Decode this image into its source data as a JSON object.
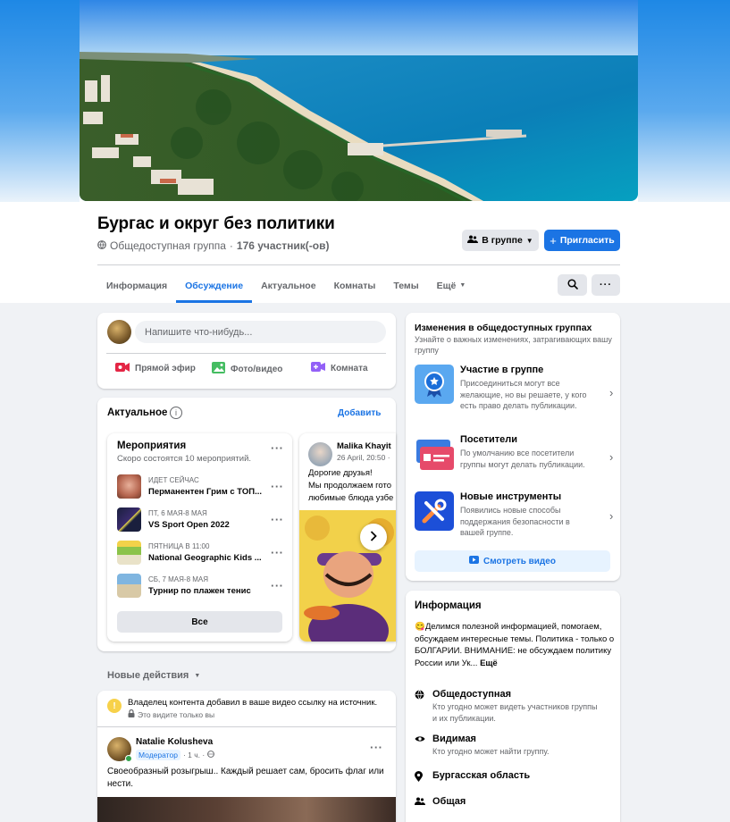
{
  "colors": {
    "accent": "#1b74e4",
    "muted": "#65676b",
    "bg": "#f0f2f5"
  },
  "group": {
    "title": "Бургас и округ без политики",
    "privacy": "Общедоступная группа",
    "separator": "·",
    "members": "176 участник(-ов)"
  },
  "actions": {
    "in_group": "В группе",
    "invite": "Пригласить"
  },
  "tabs": [
    {
      "label": "Информация",
      "active": false
    },
    {
      "label": "Обсуждение",
      "active": true
    },
    {
      "label": "Актуальное",
      "active": false
    },
    {
      "label": "Комнаты",
      "active": false
    },
    {
      "label": "Темы",
      "active": false
    },
    {
      "label": "Ещё",
      "active": false
    }
  ],
  "composer": {
    "placeholder": "Напишите что-нибудь...",
    "live": "Прямой эфир",
    "photo": "Фото/видео",
    "room": "Комната"
  },
  "featured": {
    "title": "Актуальное",
    "add": "Добавить",
    "events_card": {
      "title": "Мероприятия",
      "subtitle": "Скоро состоятся 10 мероприятий.",
      "items": [
        {
          "meta": "ИДЕТ СЕЙЧАС",
          "name": "Перманентен Грим с ТОП..."
        },
        {
          "meta": "ПТ, 6 МАЯ-8 МАЯ",
          "name": "VS Sport Open 2022"
        },
        {
          "meta": "ПЯТНИЦА В 11:00",
          "name": "National Geographic Kids ..."
        },
        {
          "meta": "СБ, 7 МАЯ-8 МАЯ",
          "name": "Турнир по плажен тенис"
        }
      ],
      "all": "Все"
    },
    "post_card": {
      "author": "Malika Khayit",
      "date": "26 April, 20:50 ·",
      "line1": "Дорогие друзья!",
      "line2": "Мы продолжаем гото",
      "line3": "любимые блюда узбе"
    }
  },
  "activity": {
    "title": "Новые действия",
    "notice": "Владелец контента добавил в ваше видео ссылку на источник.",
    "notice_sub": "Это видите только вы",
    "post": {
      "author": "Natalie Kolusheva",
      "role": "Модератор",
      "time": "· 1 ч. ·",
      "text": "Своеобразный розыгрыш.. Каждый решает сам, бросить флаг или нести."
    }
  },
  "changes": {
    "title": "Изменения в общедоступных группах",
    "subtitle": "Узнайте о важных изменениях, затрагивающих вашу группу",
    "items": [
      {
        "title": "Участие в группе",
        "text": "Присоединиться могут все желающие, но вы решаете, у кого есть право делать публикации."
      },
      {
        "title": "Посетители",
        "text": "По умолчанию все посетители группы могут делать публикации."
      },
      {
        "title": "Новые инструменты",
        "text": "Появились новые способы поддержания безопасности в вашей группе."
      }
    ],
    "video": "Смотреть видео"
  },
  "info": {
    "title": "Информация",
    "description": "😋Делимся полезной информацией, помогаем, обсуждаем интересные темы. Политика - только о БОЛГАРИИ. ВНИМАНИЕ: не обсуждаем политику России или Ук...",
    "more": "Ещё",
    "rows": [
      {
        "icon": "globe-icon",
        "title": "Общедоступная",
        "text": "Кто угодно может видеть участников группы и их публикации."
      },
      {
        "icon": "eye-icon",
        "title": "Видимая",
        "text": "Кто угодно может найти группу."
      },
      {
        "icon": "location-pin-icon",
        "title": "Бургасская область",
        "text": ""
      },
      {
        "icon": "people-icon",
        "title": "Общая",
        "text": ""
      }
    ]
  }
}
